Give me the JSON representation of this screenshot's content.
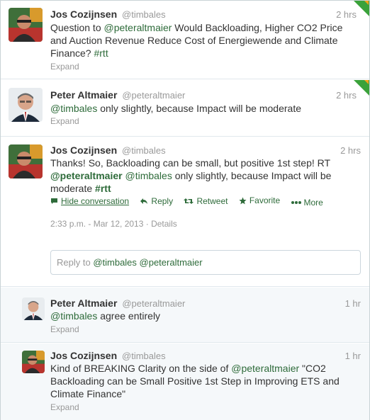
{
  "tweets": [
    {
      "fullname": "Jos Cozijnsen",
      "username": "@timbales",
      "time": "2 hrs",
      "text_parts": [
        "Question to ",
        "@peteraltmaier",
        " Would Backloading, Higher CO2 Price and Auction Revenue Reduce Cost of Energiewende and Climate Finance? ",
        "#rtt"
      ],
      "expand": "Expand"
    },
    {
      "fullname": "Peter Altmaier",
      "username": "@peteraltmaier",
      "time": "2 hrs",
      "text_parts": [
        "@timbales",
        " only slightly, because Impact will be moderate"
      ],
      "expand": "Expand"
    },
    {
      "fullname": "Jos Cozijnsen",
      "username": "@timbales",
      "time": "2 hrs",
      "text_parts": [
        "Thanks! So, Backloading can be small, but positive 1st step! RT ",
        "@peteraltmaier",
        " ",
        "@timbales",
        " only slightly, because Impact will be moderate ",
        "#rtt"
      ],
      "actions": {
        "hide": "Hide conversation",
        "reply": "Reply",
        "retweet": "Retweet",
        "favorite": "Favorite",
        "more": "More"
      },
      "meta_time": "2:33 p.m. - Mar 12, 2013",
      "meta_sep": " · ",
      "meta_details": "Details"
    }
  ],
  "reply_box": {
    "prefix": "Reply to ",
    "mentions": "@timbales @peteraltmaier"
  },
  "replies": [
    {
      "fullname": "Peter Altmaier",
      "username": "@peteraltmaier",
      "time": "1 hr",
      "text_parts": [
        "@timbales",
        " agree entirely"
      ],
      "expand": "Expand"
    },
    {
      "fullname": "Jos Cozijnsen",
      "username": "@timbales",
      "time": "1 hr",
      "text_parts": [
        "Kind of BREAKING Clarity on the side of ",
        "@peteraltmaier",
        " \"CO2 Backloading can be Small Positive 1st Step in Improving ETS and Climate Finance\""
      ],
      "expand": "Expand"
    }
  ],
  "colors": {
    "link": "#2e6b3a",
    "muted": "#999999",
    "corner_green": "#3aa23a",
    "corner_orange": "#f6a21a"
  },
  "icons": [
    "speech-bubble-icon",
    "reply-arrow-icon",
    "retweet-icon",
    "star-icon",
    "ellipsis-icon",
    "favorite-corner-icon"
  ]
}
